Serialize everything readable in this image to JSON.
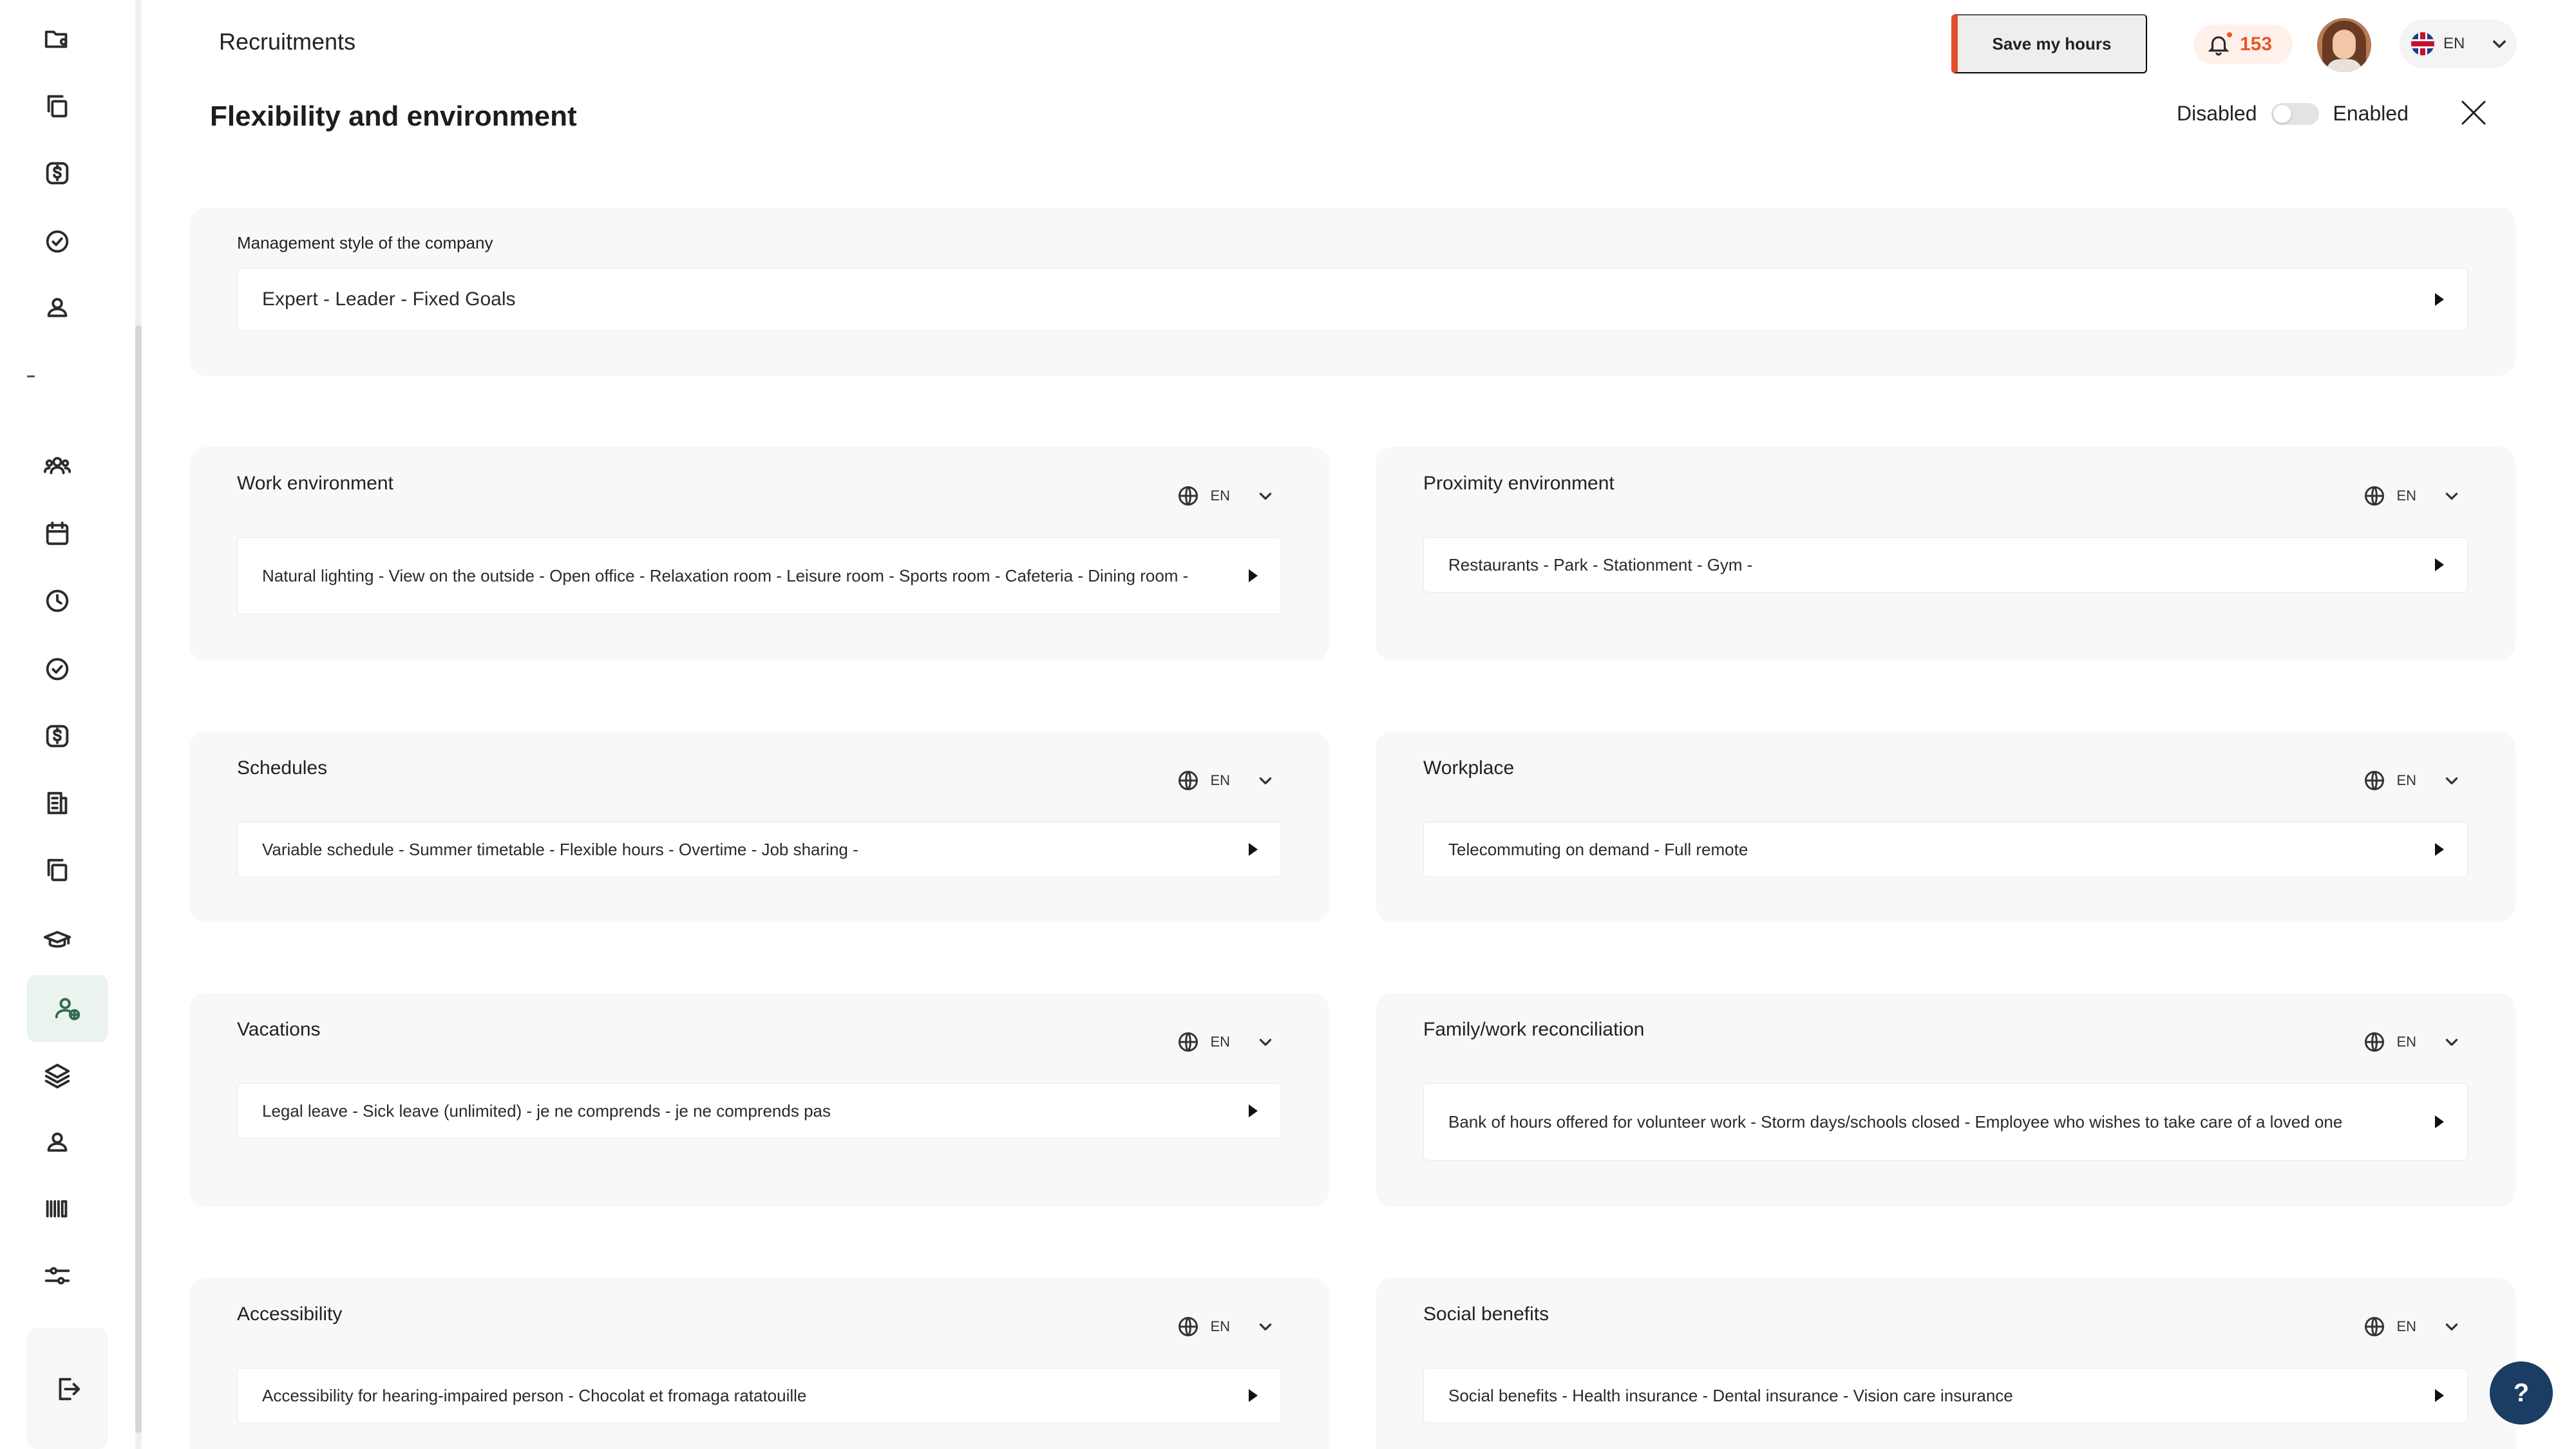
{
  "header": {
    "app_title": "Recruitments",
    "save_hours_label": "Save my hours",
    "notification_count": "153",
    "language": "EN"
  },
  "page": {
    "title": "Flexibility and environment",
    "toggle_off_label": "Disabled",
    "toggle_on_label": "Enabled",
    "toggle_enabled": false
  },
  "management": {
    "label": "Management style of the company",
    "value": "Expert - Leader - Fixed Goals"
  },
  "cards": [
    {
      "label": "Work environment",
      "lang": "EN",
      "value": "Natural lighting - View on the outside - Open office - Relaxation room - Leisure room - Sports room - Cafeteria - Dining room -"
    },
    {
      "label": "Proximity environment",
      "lang": "EN",
      "value": "Restaurants - Park - Stationment - Gym -"
    },
    {
      "label": "Schedules",
      "lang": "EN",
      "value": "Variable schedule - Summer timetable - Flexible hours - Overtime - Job sharing -"
    },
    {
      "label": "Workplace",
      "lang": "EN",
      "value": "Telecommuting on demand - Full remote"
    },
    {
      "label": "Vacations",
      "lang": "EN",
      "value": "Legal leave - Sick leave (unlimited) - je ne comprends - je ne comprends pas"
    },
    {
      "label": "Family/work reconciliation",
      "lang": "EN",
      "value": "Bank of hours offered for volunteer work - Storm days/schools closed - Employee who wishes to take care of a loved one"
    },
    {
      "label": "Accessibility",
      "lang": "EN",
      "value": "Accessibility for hearing-impaired person - Chocolat et fromaga ratatouille"
    },
    {
      "label": "Social benefits",
      "lang": "EN",
      "value": "Social benefits - Health insurance - Dental insurance - Vision care insurance"
    }
  ],
  "help_label": "?",
  "colors": {
    "accent": "#e34f2c",
    "notification": "#e6562c",
    "help_button": "#1b3d63",
    "active_nav": "#eaf3ee"
  },
  "sidebar_icons": [
    "folder-user-icon",
    "copy-icon",
    "dollar-icon",
    "check-circle-icon",
    "user-icon",
    "users-icon",
    "calendar-icon",
    "clock-icon",
    "check-circle-icon",
    "dollar-icon",
    "document-icon",
    "copy-icon",
    "graduation-cap-icon",
    "add-user-icon",
    "layers-icon",
    "user-icon",
    "barcode-icon",
    "sliders-icon",
    "logout-icon"
  ]
}
